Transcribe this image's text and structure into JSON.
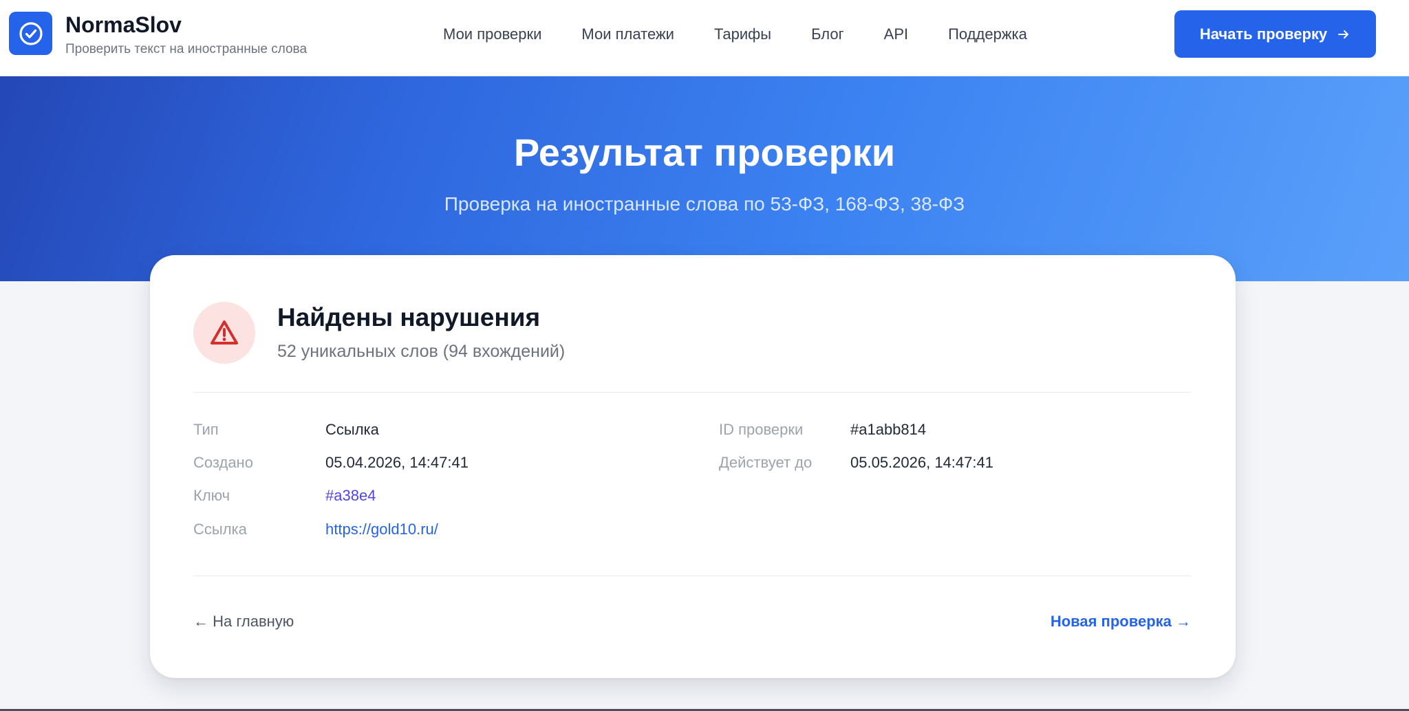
{
  "header": {
    "brand_name": "NormaSlov",
    "brand_tagline": "Проверить текст на иностранные слова",
    "logo_icon": "check-circle-icon",
    "nav": [
      {
        "label": "Мои проверки"
      },
      {
        "label": "Мои платежи"
      },
      {
        "label": "Тарифы"
      },
      {
        "label": "Блог"
      },
      {
        "label": "API"
      },
      {
        "label": "Поддержка"
      }
    ],
    "cta_label": "Начать проверку",
    "cta_icon": "arrow-right-icon"
  },
  "hero": {
    "title": "Результат проверки",
    "subtitle": "Проверка на иностранные слова по 53-ФЗ, 168-ФЗ, 38-ФЗ"
  },
  "result": {
    "status_icon": "warning-triangle-icon",
    "status_title": "Найдены нарушения",
    "status_summary": "52 уникальных слов (94 вхождений)",
    "fields_left": [
      {
        "label": "Тип",
        "value": "Ссылка"
      },
      {
        "label": "Создано",
        "value": "05.04.2026, 14:47:41"
      },
      {
        "label": "Ключ",
        "value": "#a38e4"
      },
      {
        "label": "Ссылка",
        "value": "https://gold10.ru/"
      }
    ],
    "fields_right": [
      {
        "label": "ID проверки",
        "value": "#a1abb814"
      },
      {
        "label": "Действует до",
        "value": "05.05.2026, 14:47:41"
      }
    ],
    "back_label": "← На главную",
    "new_label": "Новая проверка →"
  },
  "colors": {
    "accent": "#2563eb",
    "hero_gradient_start": "#2447b6",
    "hero_gradient_end": "#5aa0fa",
    "danger": "#d32f2f",
    "danger_bg": "#fde2e2"
  }
}
